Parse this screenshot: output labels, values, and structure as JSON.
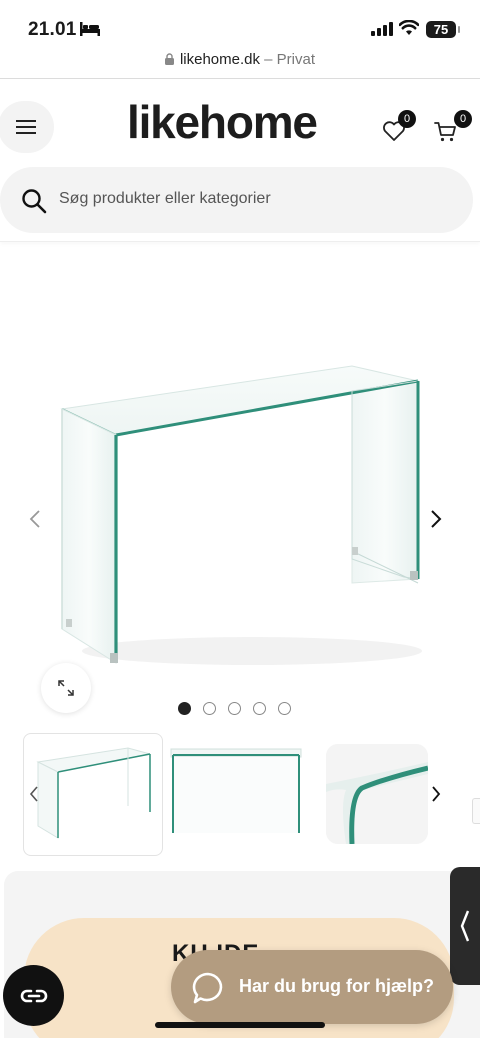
{
  "status_bar": {
    "time": "21.01",
    "battery": "75"
  },
  "browser": {
    "domain": "likehome.dk",
    "privacy_label": "– Privat"
  },
  "header": {
    "logo": "likehome",
    "wishlist_count": "0",
    "cart_count": "0",
    "search_placeholder": "Søg produkter eller kategorier"
  },
  "gallery": {
    "dots_total": 5,
    "active_dot": 1
  },
  "promo": {
    "text": "KU IDE..."
  },
  "chat": {
    "label": "Har du brug for hjælp?"
  },
  "colors": {
    "glass_edge": "#2f8f7a",
    "chat_bg": "#b39c80",
    "promo_bg": "#f7e3c7",
    "badge_bg": "#111111"
  }
}
